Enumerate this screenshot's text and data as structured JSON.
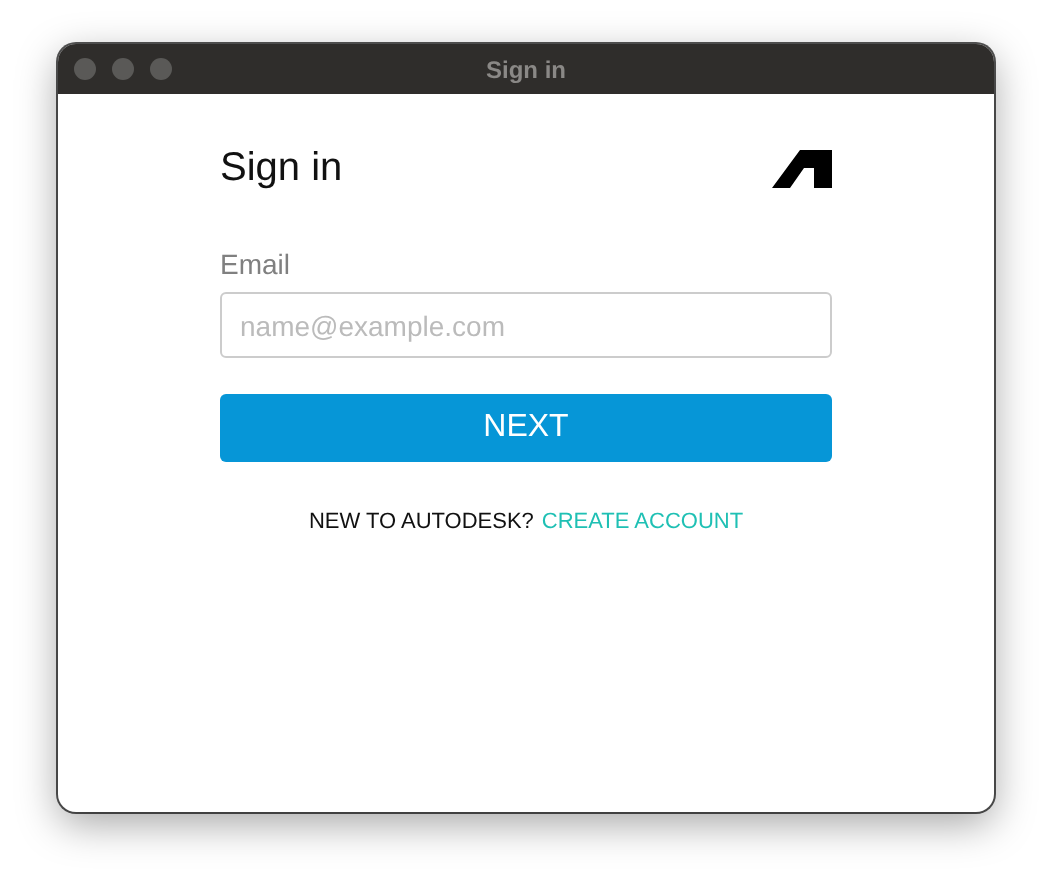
{
  "window": {
    "title": "Sign in"
  },
  "form": {
    "heading": "Sign in",
    "email_label": "Email",
    "email": {
      "placeholder": "name@example.com"
    },
    "submit": "NEXT",
    "signup_prompt": "NEW TO AUTODESK?",
    "signup_link": "CREATE ACCOUNT"
  }
}
